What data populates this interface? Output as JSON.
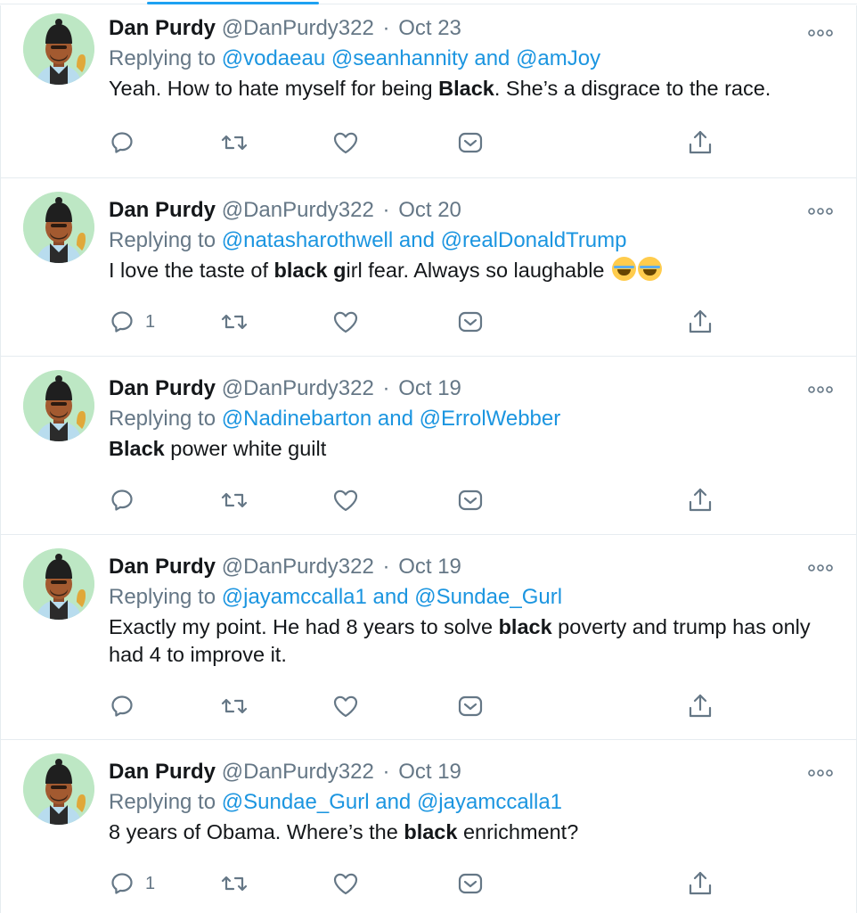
{
  "colors": {
    "accent": "#1da1f2",
    "mention": "#1b95e0",
    "muted": "#657786",
    "text": "#14171a",
    "divider": "#e6ecf0",
    "avatar_bg": "#bde7c4"
  },
  "icons": {
    "more": "more-horizontal-icon",
    "reply": "reply-bubble-icon",
    "retweet": "retweet-icon",
    "like": "heart-icon",
    "dm": "direct-message-icon",
    "share": "share-icon"
  },
  "tweets": [
    {
      "name": "Dan Purdy",
      "handle": "@DanPurdy322",
      "dot": "·",
      "date": "Oct 23",
      "replying_prefix": "Replying to ",
      "mention_1": "@vodaeau",
      "sep_1": " ",
      "mention_2": "@seanhannity",
      "conj": " and ",
      "mention_3": "@amJoy",
      "text_1": "Yeah. How to hate myself for being ",
      "text_bold": "Black",
      "text_2": ". She’s a disgrace to the race.",
      "reply_count": ""
    },
    {
      "name": "Dan Purdy",
      "handle": "@DanPurdy322",
      "dot": "·",
      "date": "Oct 20",
      "replying_prefix": "Replying to ",
      "mention_1": "@natasharothwell",
      "conj": " and ",
      "mention_2": "@realDonaldTrump",
      "text_1": "I love the taste of ",
      "text_bold": "black g",
      "text_2": "irl fear. Always so laughable ",
      "emoji_icon": "tears-of-joy-emoji-icon",
      "reply_count": "1"
    },
    {
      "name": "Dan Purdy",
      "handle": "@DanPurdy322",
      "dot": "·",
      "date": "Oct 19",
      "replying_prefix": "Replying to ",
      "mention_1": "@Nadinebarton",
      "conj": " and ",
      "mention_2": "@ErrolWebber",
      "text_1": "",
      "text_bold": "Black",
      "text_2": " power white guilt",
      "reply_count": ""
    },
    {
      "name": "Dan Purdy",
      "handle": "@DanPurdy322",
      "dot": "·",
      "date": "Oct 19",
      "replying_prefix": "Replying to ",
      "mention_1": "@jayamccalla1",
      "conj": " and ",
      "mention_2": "@Sundae_Gurl",
      "text_1": "Exactly my point. He had 8 years to solve ",
      "text_bold": "black",
      "text_2": " poverty and trump has only had 4 to improve it.",
      "reply_count": ""
    },
    {
      "name": "Dan Purdy",
      "handle": "@DanPurdy322",
      "dot": "·",
      "date": "Oct 19",
      "replying_prefix": "Replying to ",
      "mention_1": "@Sundae_Gurl",
      "conj": " and ",
      "mention_2": "@jayamccalla1",
      "text_1": "8 years of Obama. Where’s the ",
      "text_bold": "black",
      "text_2": " enrichment?",
      "reply_count": "1"
    }
  ]
}
